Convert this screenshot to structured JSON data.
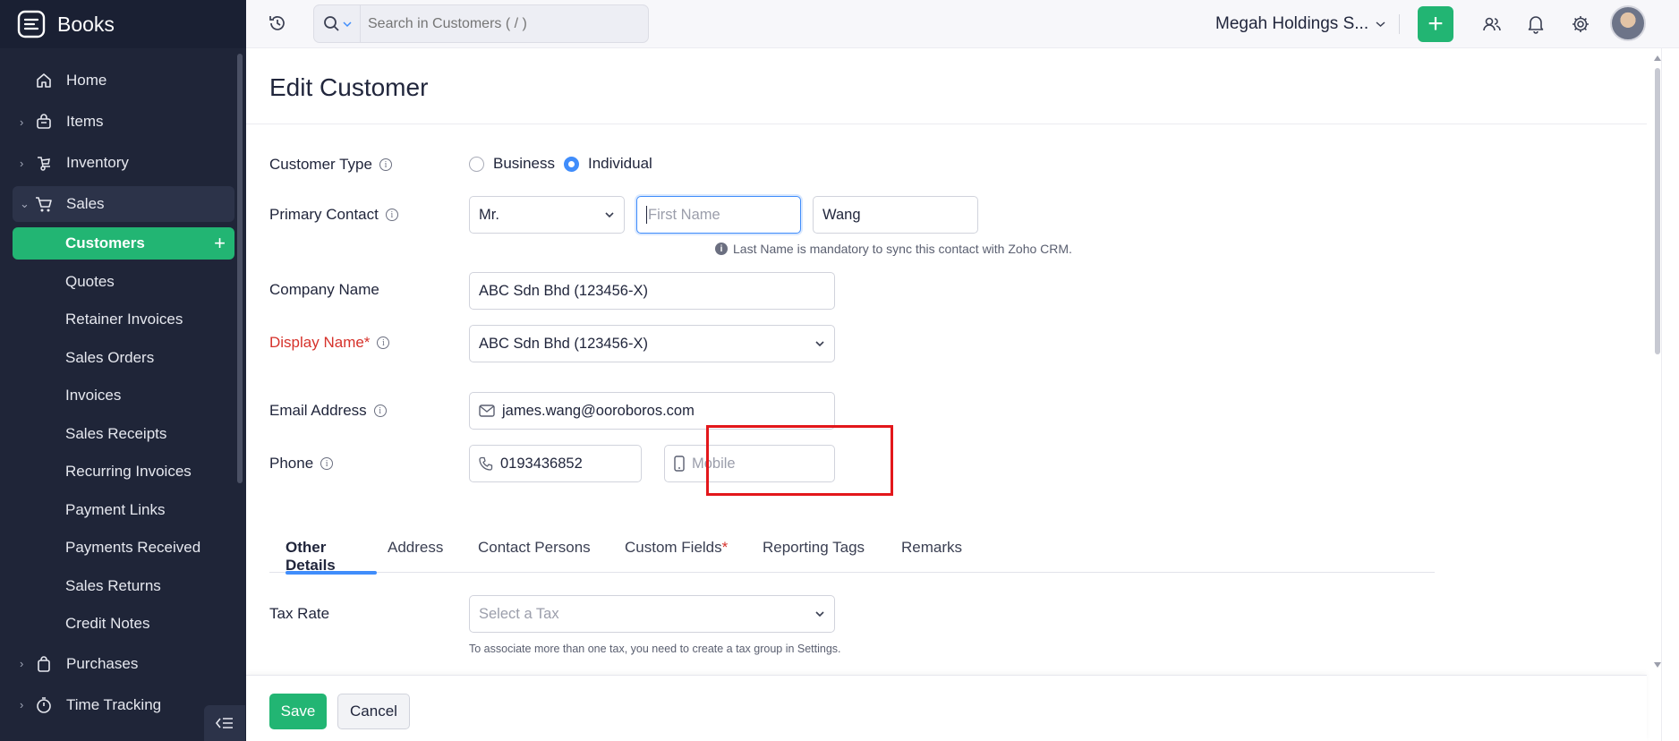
{
  "app": {
    "name": "Books"
  },
  "sidebar": {
    "items": [
      {
        "label": "Home",
        "icon": "home-icon"
      },
      {
        "label": "Items",
        "icon": "basket-icon"
      },
      {
        "label": "Inventory",
        "icon": "inventory-icon"
      },
      {
        "label": "Sales",
        "icon": "cart-icon"
      }
    ],
    "sales_sub": [
      "Customers",
      "Quotes",
      "Retainer Invoices",
      "Sales Orders",
      "Invoices",
      "Sales Receipts",
      "Recurring Invoices",
      "Payment Links",
      "Payments Received",
      "Sales Returns",
      "Credit Notes"
    ],
    "bottom_items": [
      {
        "label": "Purchases",
        "icon": "bag-icon"
      },
      {
        "label": "Time Tracking",
        "icon": "stopwatch-icon"
      }
    ]
  },
  "topbar": {
    "search_placeholder": "Search in Customers ( / )",
    "org_name": "Megah Holdings S..."
  },
  "page": {
    "title": "Edit Customer"
  },
  "form": {
    "customer_type": {
      "label": "Customer Type",
      "options": [
        "Business",
        "Individual"
      ],
      "selected": "Individual"
    },
    "primary_contact": {
      "label": "Primary Contact",
      "salutation": "Mr.",
      "first_name_placeholder": "First Name",
      "last_name": "Wang",
      "hint": "Last Name is mandatory to sync this contact with Zoho CRM."
    },
    "company_name": {
      "label": "Company Name",
      "value": "ABC Sdn Bhd (123456-X)"
    },
    "display_name": {
      "label": "Display Name*",
      "value": "ABC Sdn Bhd (123456-X)"
    },
    "email": {
      "label": "Email Address",
      "value": "james.wang@ooroboros.com"
    },
    "phone": {
      "label": "Phone",
      "work": "0193436852",
      "mobile_placeholder": "Mobile"
    },
    "tax_rate": {
      "label": "Tax Rate",
      "placeholder": "Select a Tax",
      "note": "To associate more than one tax, you need to create a tax group in Settings."
    }
  },
  "tabs": [
    {
      "label": "Other Details"
    },
    {
      "label": "Address"
    },
    {
      "label": "Contact Persons"
    },
    {
      "label": "Custom Fields"
    },
    {
      "label": "Reporting Tags"
    },
    {
      "label": "Remarks"
    }
  ],
  "tabs_active": "Other Details",
  "footer": {
    "save": "Save",
    "cancel": "Cancel"
  },
  "colors": {
    "accent": "#22b573",
    "focus": "#408dfb",
    "required": "#d6322b",
    "sidebar_bg": "#1f2538",
    "highlight": "#e3171b"
  }
}
